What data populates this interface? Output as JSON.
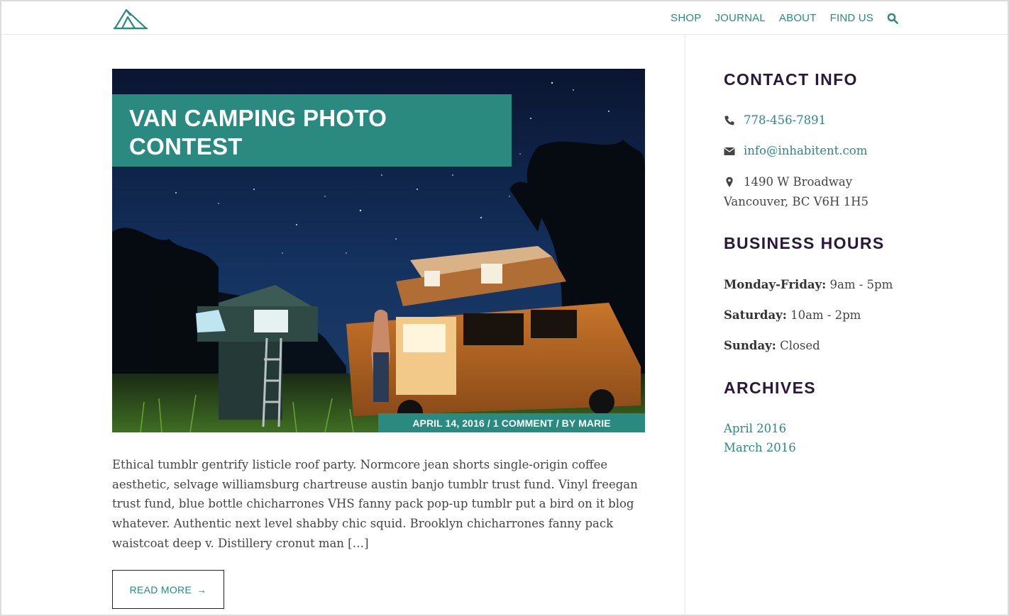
{
  "nav": {
    "items": [
      "SHOP",
      "JOURNAL",
      "ABOUT",
      "FIND US"
    ],
    "search_icon": "search-icon"
  },
  "post": {
    "title": "VAN CAMPING PHOTO CONTEST",
    "meta": "APRIL 14, 2016 / 1 COMMENT / BY MARIE",
    "excerpt": "Ethical tumblr gentrify listicle roof party. Normcore jean shorts single-origin coffee aesthetic, selvage williamsburg chartreuse austin banjo tumblr trust fund. Vinyl freegan trust fund, blue bottle chicharrones VHS fanny pack pop-up tumblr put a bird on it blog whatever. Authentic next level shabby chic squid. Brooklyn chicharrones fanny pack waistcoat deep v. Distillery cronut man […]",
    "read_more": "READ MORE",
    "read_more_arrow": "→"
  },
  "sidebar": {
    "contact": {
      "title": "CONTACT INFO",
      "phone": "778-456-7891",
      "email": "info@inhabitent.com",
      "address_line1": "1490 W Broadway",
      "address_line2": "Vancouver, BC V6H 1H5"
    },
    "hours": {
      "title": "BUSINESS HOURS",
      "rows": [
        {
          "day": "Monday-Friday:",
          "time": "9am - 5pm"
        },
        {
          "day": "Saturday:",
          "time": "10am - 2pm"
        },
        {
          "day": "Sunday:",
          "time": "Closed"
        }
      ]
    },
    "archives": {
      "title": "ARCHIVES",
      "items": [
        "April 2016",
        "March 2016"
      ]
    }
  },
  "colors": {
    "accent": "#2a8a80",
    "heading": "#2a1838",
    "text": "#444444"
  }
}
